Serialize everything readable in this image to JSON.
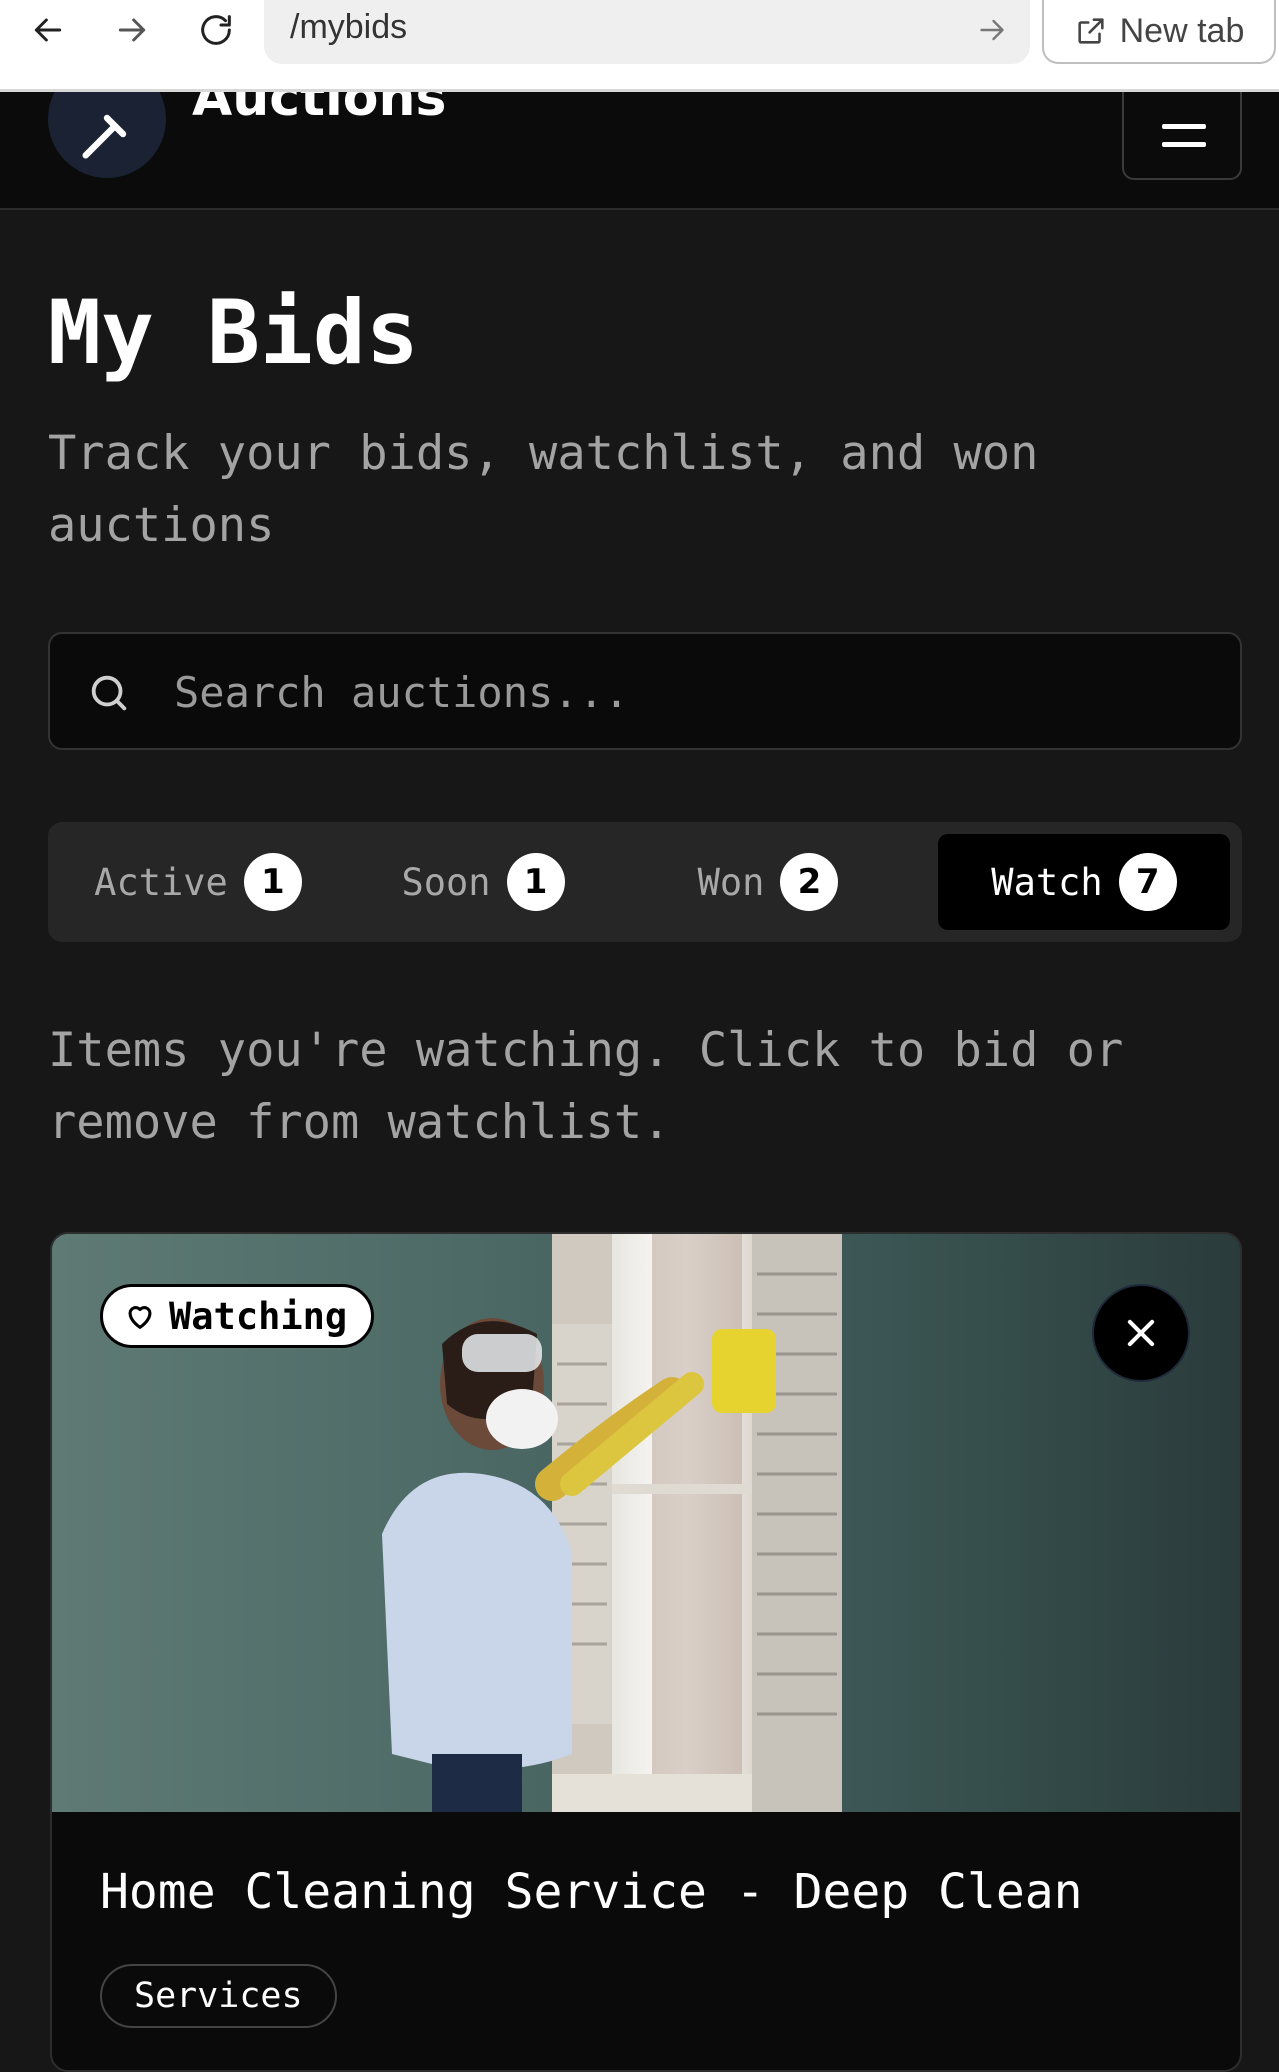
{
  "browser": {
    "url": "/mybids",
    "new_tab_label": "New tab"
  },
  "header": {
    "brand": "Auctions"
  },
  "page": {
    "title": "My Bids",
    "subtitle": "Track your bids, watchlist, and won auctions"
  },
  "search": {
    "placeholder": "Search auctions...",
    "value": ""
  },
  "tabs": [
    {
      "label": "Active",
      "count": "1",
      "active": false
    },
    {
      "label": "Soon",
      "count": "1",
      "active": false
    },
    {
      "label": "Won",
      "count": "2",
      "active": false
    },
    {
      "label": "Watch",
      "count": "7",
      "active": true
    }
  ],
  "tab_description": "Items you're watching. Click to bid or remove from watchlist.",
  "cards": [
    {
      "badge": "Watching",
      "title": "Home Cleaning Service - Deep Clean",
      "category": "Services",
      "image": "woman-cleaning-window-photo"
    }
  ]
}
